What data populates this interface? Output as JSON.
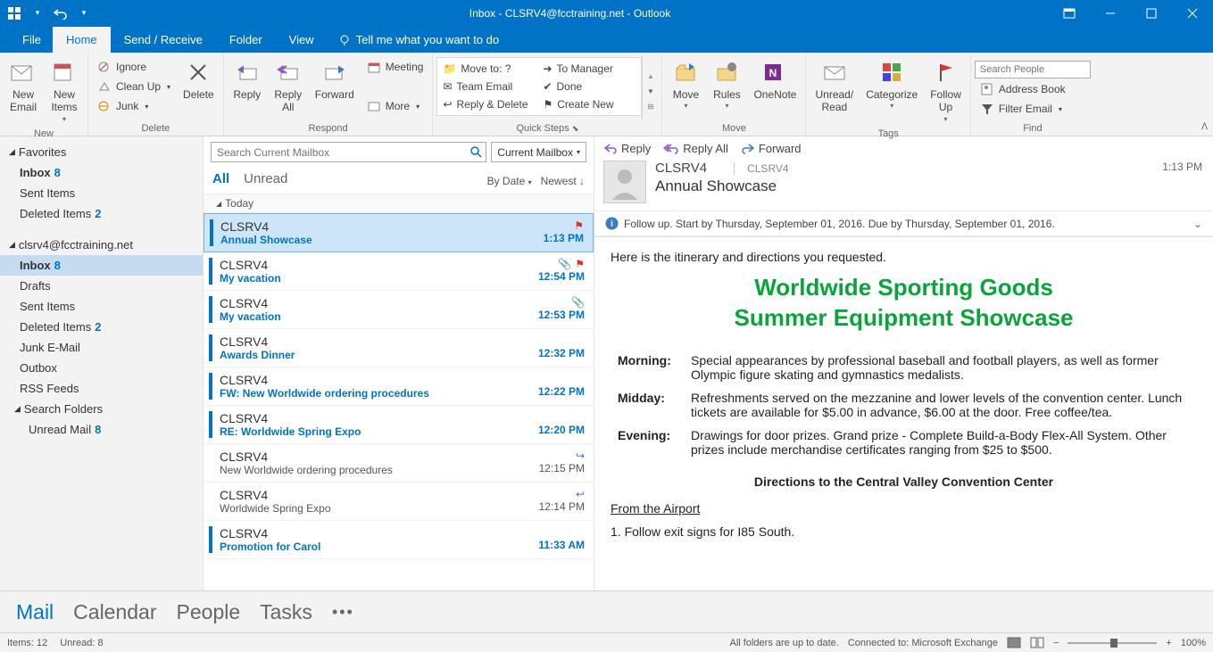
{
  "title": "Inbox - CLSRV4@fcctraining.net - Outlook",
  "menubar": {
    "file": "File",
    "home": "Home",
    "sendrecv": "Send / Receive",
    "folder": "Folder",
    "view": "View",
    "tellme": "Tell me what you want to do"
  },
  "ribbon": {
    "new": {
      "email": "New\nEmail",
      "items": "New\nItems",
      "label": "New"
    },
    "delete": {
      "ignore": "Ignore",
      "cleanup": "Clean Up",
      "junk": "Junk",
      "delete": "Delete",
      "label": "Delete"
    },
    "respond": {
      "reply": "Reply",
      "replyall": "Reply\nAll",
      "forward": "Forward",
      "meeting": "Meeting",
      "more": "More",
      "label": "Respond"
    },
    "quicksteps": {
      "moveto": "Move to: ?",
      "team": "Team Email",
      "replydel": "Reply & Delete",
      "tomgr": "To Manager",
      "done": "Done",
      "create": "Create New",
      "label": "Quick Steps"
    },
    "move": {
      "move": "Move",
      "rules": "Rules",
      "onenote": "OneNote",
      "label": "Move"
    },
    "tags": {
      "unread": "Unread/\nRead",
      "categorize": "Categorize",
      "followup": "Follow\nUp",
      "label": "Tags"
    },
    "find": {
      "search_ph": "Search People",
      "address": "Address Book",
      "filter": "Filter Email",
      "label": "Find"
    }
  },
  "nav": {
    "favorites": "Favorites",
    "fav_items": [
      {
        "label": "Inbox",
        "count": "8",
        "bold": true
      },
      {
        "label": "Sent Items"
      },
      {
        "label": "Deleted Items",
        "count": "2"
      }
    ],
    "account": "clsrv4@fcctraining.net",
    "acct_items": [
      {
        "label": "Inbox",
        "count": "8",
        "bold": true,
        "sel": true
      },
      {
        "label": "Drafts"
      },
      {
        "label": "Sent Items"
      },
      {
        "label": "Deleted Items",
        "count": "2"
      },
      {
        "label": "Junk E-Mail"
      },
      {
        "label": "Outbox"
      },
      {
        "label": "RSS Feeds"
      }
    ],
    "search": "Search Folders",
    "search_items": [
      {
        "label": "Unread Mail",
        "count": "8"
      }
    ]
  },
  "msglist": {
    "search_ph": "Search Current Mailbox",
    "scope": "Current Mailbox",
    "tab_all": "All",
    "tab_unread": "Unread",
    "sort_by": "By Date",
    "sort_dir": "Newest",
    "group": "Today",
    "items": [
      {
        "from": "CLSRV4",
        "subj": "Annual Showcase",
        "time": "1:13 PM",
        "unread": true,
        "sel": true,
        "flag": true
      },
      {
        "from": "CLSRV4",
        "subj": "My vacation",
        "time": "12:54 PM",
        "unread": true,
        "attach": true,
        "flag": true
      },
      {
        "from": "CLSRV4",
        "subj": "My vacation",
        "time": "12:53 PM",
        "unread": true,
        "attach": true
      },
      {
        "from": "CLSRV4",
        "subj": "Awards Dinner",
        "time": "12:32 PM",
        "unread": true
      },
      {
        "from": "CLSRV4",
        "subj": "FW: New Worldwide ordering procedures",
        "time": "12:22 PM",
        "unread": true
      },
      {
        "from": "CLSRV4",
        "subj": "RE: Worldwide Spring Expo",
        "time": "12:20 PM",
        "unread": true
      },
      {
        "from": "CLSRV4",
        "subj": "New Worldwide ordering procedures",
        "time": "12:15 PM",
        "unread": false,
        "fwd": true
      },
      {
        "from": "CLSRV4",
        "subj": "Worldwide Spring Expo",
        "time": "12:14 PM",
        "unread": false,
        "replied": true
      },
      {
        "from": "CLSRV4",
        "subj": "Promotion for Carol",
        "time": "11:33 AM",
        "unread": true
      }
    ]
  },
  "reading": {
    "reply": "Reply",
    "replyall": "Reply All",
    "forward": "Forward",
    "sender": "CLSRV4",
    "account": "CLSRV4",
    "subject": "Annual Showcase",
    "time": "1:13 PM",
    "followup": "Follow up.  Start by Thursday, September 01, 2016.  Due by Thursday, September 01, 2016.",
    "intro": "Here is the itinerary and directions you requested.",
    "title1": "Worldwide Sporting Goods",
    "title2": "Summer Equipment Showcase",
    "rows": [
      {
        "k": "Morning:",
        "v": "Special appearances by professional baseball and football players, as well as former Olympic figure skating and gymnastics medalists."
      },
      {
        "k": "Midday:",
        "v": "Refreshments served on the mezzanine and lower levels of the convention center. Lunch tickets are available for $5.00 in advance, $6.00 at the door. Free coffee/tea."
      },
      {
        "k": "Evening:",
        "v": "Drawings for door prizes. Grand prize - Complete Build-a-Body Flex-All System. Other prizes include merchandise certificates ranging from $25 to $500."
      }
    ],
    "directions": "Directions to the Central Valley Convention Center",
    "from_airport": "From the Airport",
    "step1": "1.    Follow exit signs for I85 South."
  },
  "navbar": {
    "mail": "Mail",
    "calendar": "Calendar",
    "people": "People",
    "tasks": "Tasks"
  },
  "status": {
    "items": "Items: 12",
    "unread": "Unread: 8",
    "sync": "All folders are up to date.",
    "conn": "Connected to: Microsoft Exchange",
    "zoom": "100%"
  }
}
